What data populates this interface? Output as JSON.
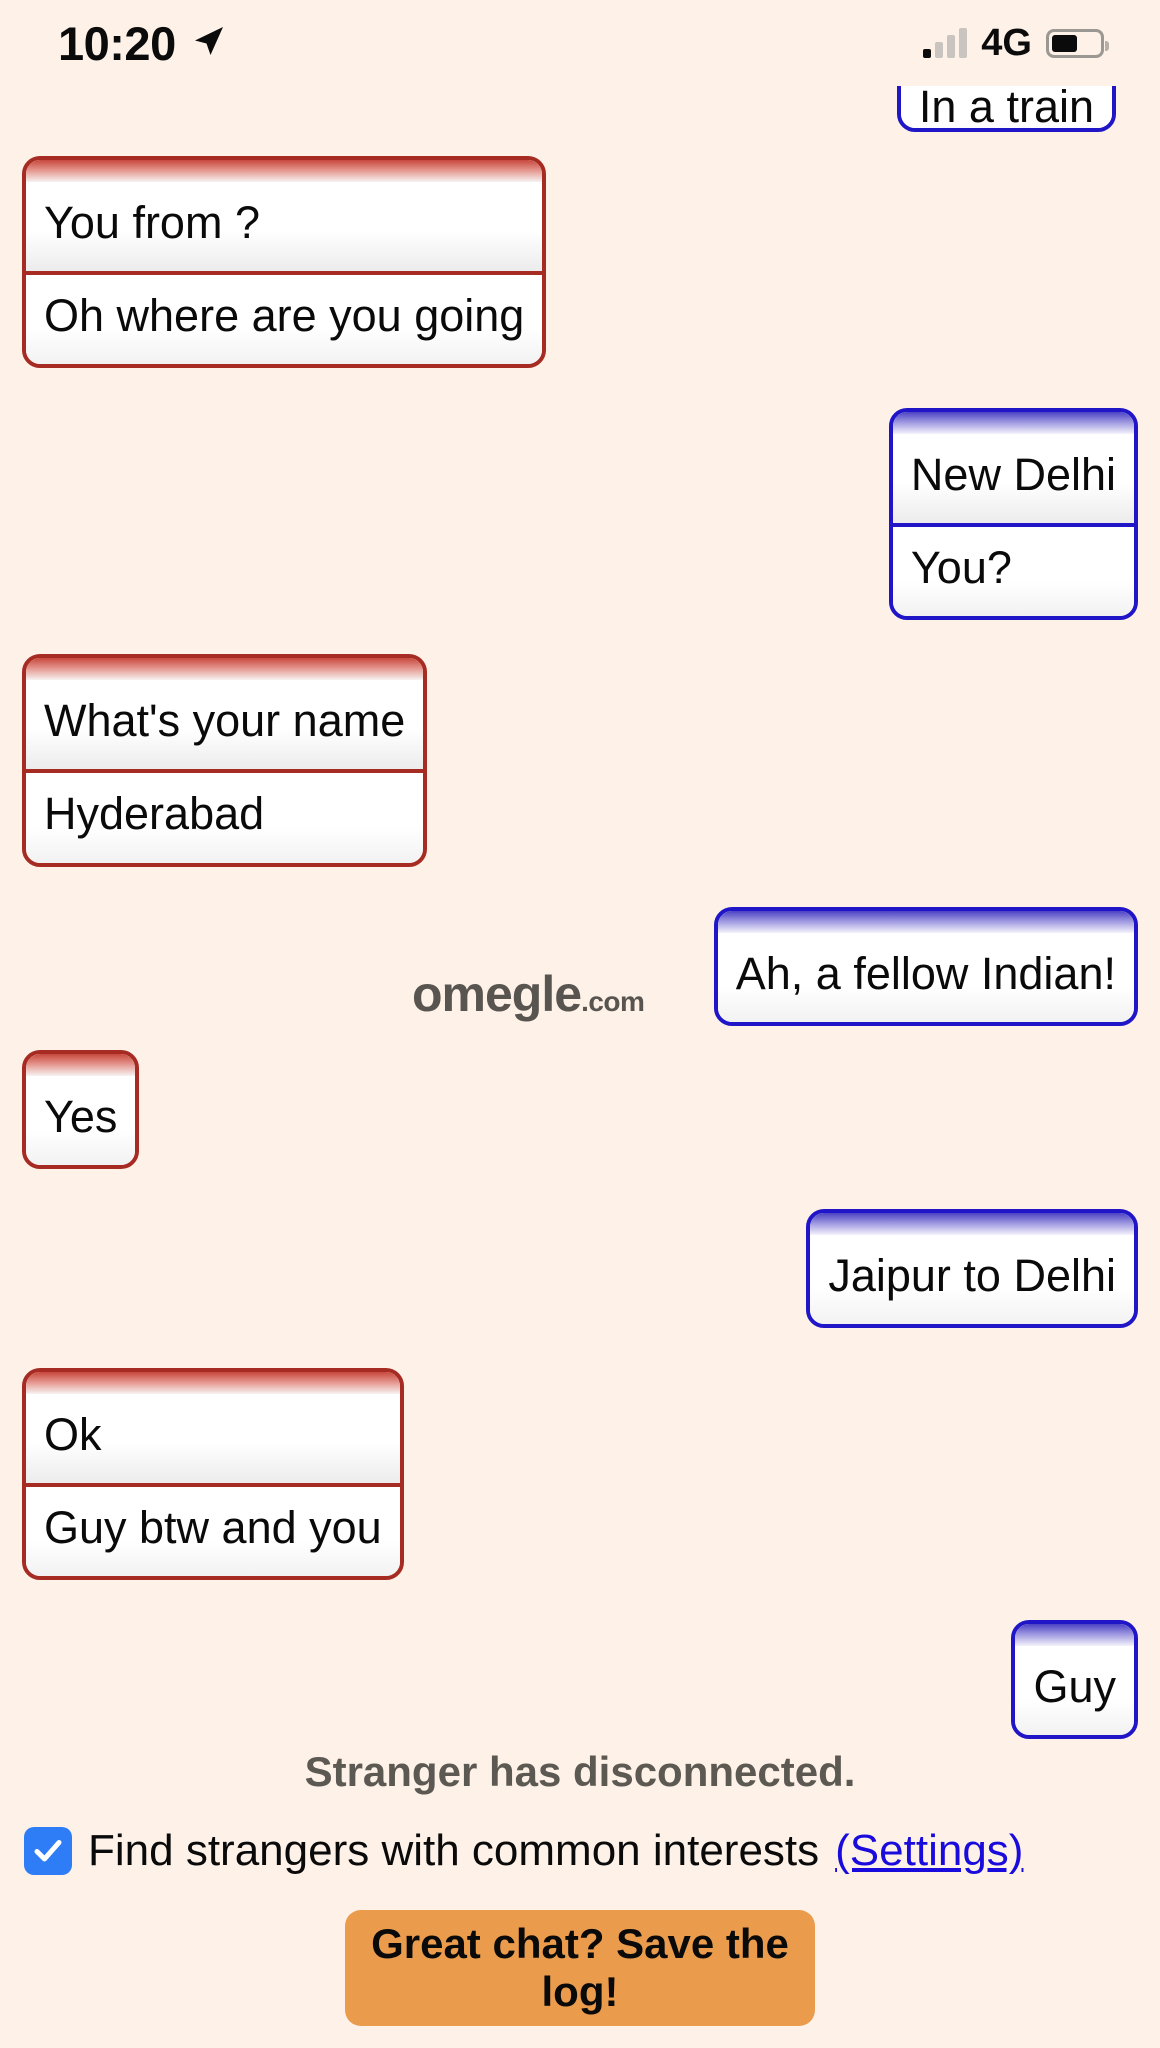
{
  "status_bar": {
    "time": "10:20",
    "location_icon": "location-arrow-icon",
    "signal_icon": "signal-bars-icon",
    "network": "4G",
    "battery_icon": "battery-icon"
  },
  "watermark": {
    "main": "omegle",
    "tld": ".com"
  },
  "chat": {
    "groups": [
      {
        "sender": "you",
        "align": "right",
        "clipped": true,
        "messages": [
          "In a train"
        ]
      },
      {
        "sender": "stranger",
        "align": "left",
        "messages": [
          "You from ?",
          "Oh where are you going"
        ]
      },
      {
        "sender": "you",
        "align": "right",
        "messages": [
          "New Delhi",
          "You?"
        ]
      },
      {
        "sender": "stranger",
        "align": "left",
        "messages": [
          "What's your name",
          "Hyderabad"
        ]
      },
      {
        "sender": "you",
        "align": "right",
        "messages": [
          "Ah, a fellow Indian!"
        ]
      },
      {
        "sender": "stranger",
        "align": "left",
        "messages": [
          "Yes"
        ]
      },
      {
        "sender": "you",
        "align": "right",
        "messages": [
          "Jaipur to Delhi"
        ]
      },
      {
        "sender": "stranger",
        "align": "left",
        "messages": [
          "Ok",
          "Guy btw and you"
        ]
      },
      {
        "sender": "you",
        "align": "right",
        "messages": [
          "Guy"
        ]
      }
    ]
  },
  "footer": {
    "disconnect_notice": "Stranger has disconnected.",
    "interests_label": "Find strangers with common interests",
    "settings_link": "(Settings)",
    "interests_checked": true,
    "save_button": "Great chat? Save the log!"
  },
  "colors": {
    "background": "#fdf1e8",
    "stranger_border": "#a62b23",
    "you_border": "#2016c8",
    "checkbox": "#2f7df6",
    "link": "#1a0bdd",
    "save_button": "#eb9b4c",
    "status_text": "#5c5852",
    "watermark": "#58544f"
  }
}
